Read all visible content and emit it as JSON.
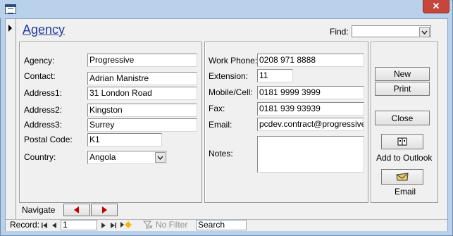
{
  "window": {
    "close_glyph": "✕"
  },
  "form": {
    "title": "Agency",
    "find_label": "Find:",
    "find_value": ""
  },
  "left_panel": {
    "fields": [
      {
        "label": "Agency:",
        "value": "Progressive"
      },
      {
        "label": "Contact:",
        "value": "Adrian Manistre"
      },
      {
        "label": "Address1:",
        "value": "31 London Road"
      },
      {
        "label": "Address2:",
        "value": "Kingston"
      },
      {
        "label": "Address3:",
        "value": "Surrey"
      },
      {
        "label": "Postal Code:",
        "value": "K1"
      },
      {
        "label": "Country:",
        "value": "Angola"
      }
    ]
  },
  "middle_panel": {
    "fields": [
      {
        "label": "Work Phone:",
        "value": "0208 971 8888"
      },
      {
        "label": "Extension:",
        "value": "11"
      },
      {
        "label": "Mobile/Cell:",
        "value": "0181 9999 3999"
      },
      {
        "label": "Fax:",
        "value": "0181 939 93939"
      },
      {
        "label": "Email:",
        "value": "pcdev.contract@progressive.c"
      },
      {
        "label": "Notes:",
        "value": ""
      }
    ]
  },
  "right_panel": {
    "new_label": "New",
    "print_label": "Print",
    "close_label": "Close",
    "outlook_label": "Add to Outlook",
    "email_label": "Email"
  },
  "navigate": {
    "label": "Navigate",
    "prev_icon": "left-triangle",
    "next_icon": "right-triangle",
    "icon_color": "#c00000"
  },
  "record_bar": {
    "record_label": "Record:",
    "current_record": "1",
    "no_filter_label": "No Filter",
    "search_placeholder": "Search"
  }
}
